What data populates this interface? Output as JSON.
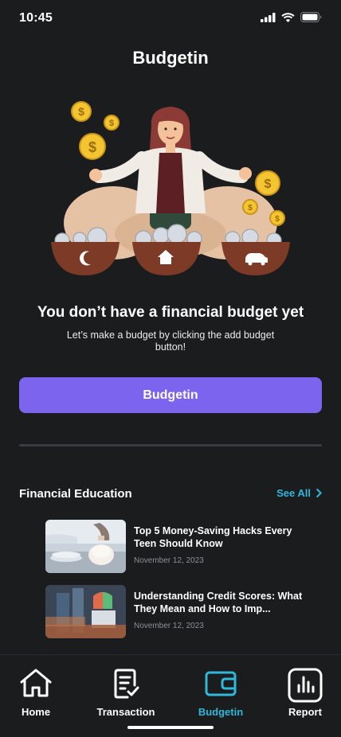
{
  "status_bar": {
    "time": "10:45"
  },
  "header": {
    "title": "Budgetin"
  },
  "empty_state": {
    "title": "You don’t have a financial budget yet",
    "description": "Let’s make  a budget by clicking the add budget button!",
    "button_label": "Budgetin"
  },
  "education": {
    "title": "Financial Education",
    "see_all": "See All",
    "articles": [
      {
        "title": "Top 5 Money-Saving Hacks Every Teen Should Know",
        "date": "November 12, 2023"
      },
      {
        "title": "Understanding Credit Scores: What They Mean and How to Imp...",
        "date": "November 12, 2023"
      }
    ]
  },
  "tabs": [
    {
      "label": "Home",
      "icon": "home-icon"
    },
    {
      "label": "Transaction",
      "icon": "receipt-icon"
    },
    {
      "label": "Budgetin",
      "icon": "wallet-icon",
      "active": true
    },
    {
      "label": "Report",
      "icon": "chart-icon"
    }
  ],
  "colors": {
    "background": "#1b1c1e",
    "primary": "#7c64ef",
    "accent": "#2fb8d9"
  }
}
